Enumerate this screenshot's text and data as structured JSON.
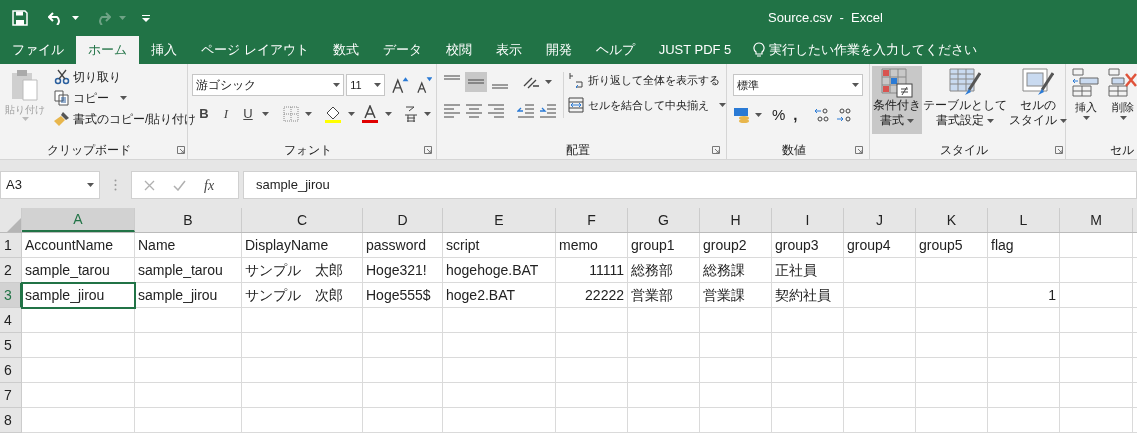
{
  "window": {
    "title": "Source.csv  -  Excel"
  },
  "tabs": [
    {
      "label": "ファイル",
      "selected": false
    },
    {
      "label": "ホーム",
      "selected": true
    },
    {
      "label": "挿入",
      "selected": false
    },
    {
      "label": "ページ レイアウト",
      "selected": false
    },
    {
      "label": "数式",
      "selected": false
    },
    {
      "label": "データ",
      "selected": false
    },
    {
      "label": "校閲",
      "selected": false
    },
    {
      "label": "表示",
      "selected": false
    },
    {
      "label": "開発",
      "selected": false
    },
    {
      "label": "ヘルプ",
      "selected": false
    },
    {
      "label": "JUST PDF 5",
      "selected": false
    }
  ],
  "tell_me": {
    "placeholder": "実行したい作業を入力してください"
  },
  "ribbon": {
    "clipboard": {
      "label": "クリップボード",
      "paste": {
        "label": "貼り付け",
        "disabled": true
      },
      "cut": "切り取り",
      "copy": "コピー",
      "format_painter": "書式のコピー/貼り付け"
    },
    "font": {
      "label": "フォント",
      "font_name": "游ゴシック",
      "font_size": "11",
      "styles": [
        "B",
        "I",
        "U"
      ]
    },
    "alignment": {
      "label": "配置",
      "wrap_text": "折り返して全体を表示する",
      "merge_center": "セルを結合して中央揃え"
    },
    "number": {
      "label": "数値",
      "format": "標準",
      "percent": "%",
      "comma": ","
    },
    "styles": {
      "label": "スタイル",
      "buttons": [
        {
          "lines": [
            "条件付き",
            "書式"
          ],
          "hovered": true
        },
        {
          "lines": [
            "テーブルとして",
            "書式設定"
          ],
          "hovered": false
        },
        {
          "lines": [
            "セルの",
            "スタイル"
          ],
          "hovered": false
        }
      ]
    },
    "cells": {
      "label": "セル",
      "buttons": [
        "挿入",
        "削除"
      ]
    }
  },
  "formula_bar": {
    "name_box": "A3",
    "function_label": "fx",
    "value": "sample_jirou"
  },
  "columns": [
    {
      "label": "A",
      "selected": true
    },
    {
      "label": "B",
      "selected": false
    },
    {
      "label": "C",
      "selected": false
    },
    {
      "label": "D",
      "selected": false
    },
    {
      "label": "E",
      "selected": false
    },
    {
      "label": "F",
      "selected": false
    },
    {
      "label": "G",
      "selected": false
    },
    {
      "label": "H",
      "selected": false
    },
    {
      "label": "I",
      "selected": false
    },
    {
      "label": "J",
      "selected": false
    },
    {
      "label": "K",
      "selected": false
    },
    {
      "label": "L",
      "selected": false
    },
    {
      "label": "M",
      "selected": false
    }
  ],
  "rows": [
    {
      "number": "1",
      "selected": false,
      "cells": [
        {
          "text": "AccountName",
          "kind": "text",
          "active": false
        },
        {
          "text": "Name",
          "kind": "text",
          "active": false
        },
        {
          "text": "DisplayName",
          "kind": "text",
          "active": false
        },
        {
          "text": "password",
          "kind": "text",
          "active": false
        },
        {
          "text": "script",
          "kind": "text",
          "active": false
        },
        {
          "text": "memo",
          "kind": "text",
          "active": false
        },
        {
          "text": "group1",
          "kind": "text",
          "active": false
        },
        {
          "text": "group2",
          "kind": "text",
          "active": false
        },
        {
          "text": "group3",
          "kind": "text",
          "active": false
        },
        {
          "text": "group4",
          "kind": "text",
          "active": false
        },
        {
          "text": "group5",
          "kind": "text",
          "active": false
        },
        {
          "text": "flag",
          "kind": "text",
          "active": false
        }
      ]
    },
    {
      "number": "2",
      "selected": false,
      "cells": [
        {
          "text": "sample_tarou",
          "kind": "text",
          "active": false
        },
        {
          "text": "sample_tarou",
          "kind": "text",
          "active": false
        },
        {
          "text": "サンプル　太郎",
          "kind": "text",
          "active": false
        },
        {
          "text": "Hoge321!",
          "kind": "text",
          "active": false
        },
        {
          "text": "hogehoge.BAT",
          "kind": "text",
          "active": false
        },
        {
          "text": "11111",
          "kind": "number",
          "active": false
        },
        {
          "text": "総務部",
          "kind": "text",
          "active": false
        },
        {
          "text": "総務課",
          "kind": "text",
          "active": false
        },
        {
          "text": "正社員",
          "kind": "text",
          "active": false
        }
      ]
    },
    {
      "number": "3",
      "selected": true,
      "cells": [
        {
          "text": "sample_jirou",
          "kind": "text",
          "active": true
        },
        {
          "text": "sample_jirou",
          "kind": "text",
          "active": false
        },
        {
          "text": "サンプル　次郎",
          "kind": "text",
          "active": false
        },
        {
          "text": "Hoge555$",
          "kind": "text",
          "active": false
        },
        {
          "text": "hoge2.BAT",
          "kind": "text",
          "active": false
        },
        {
          "text": "22222",
          "kind": "number",
          "active": false
        },
        {
          "text": "営業部",
          "kind": "text",
          "active": false
        },
        {
          "text": "営業課",
          "kind": "text",
          "active": false
        },
        {
          "text": "契約社員",
          "kind": "text",
          "active": false
        },
        {
          "kind": "blank"
        },
        {
          "kind": "blank"
        },
        {
          "text": "1",
          "kind": "number",
          "active": false
        }
      ]
    },
    {
      "number": "4",
      "selected": false
    },
    {
      "number": "5",
      "selected": false
    },
    {
      "number": "6",
      "selected": false
    },
    {
      "number": "7",
      "selected": false
    },
    {
      "number": "8",
      "selected": false
    }
  ]
}
